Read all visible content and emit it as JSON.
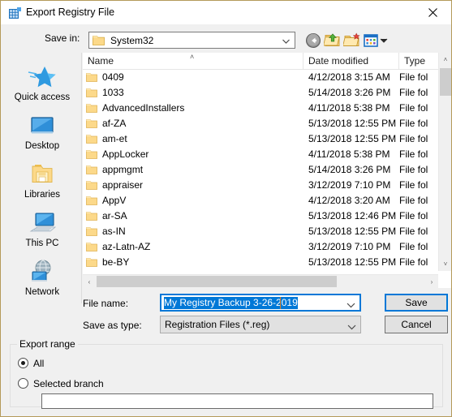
{
  "window": {
    "title": "Export Registry File",
    "icon": "registry-editor-icon",
    "close_label": "✕",
    "border_color": "#b49a5a"
  },
  "toolbar": {
    "savein_label": "Save in:",
    "savein_value": "System32",
    "savein_folder_icon": "folder-icon",
    "dropdown_arrow": "chevron-down-icon",
    "buttons": [
      {
        "name": "back-button",
        "icon": "back-arrow-icon"
      },
      {
        "name": "up-one-level-button",
        "icon": "folder-up-arrow-icon"
      },
      {
        "name": "new-folder-button",
        "icon": "new-folder-icon"
      },
      {
        "name": "views-button",
        "icon": "views-grid-icon"
      }
    ]
  },
  "places": {
    "items": [
      {
        "label": "Quick access",
        "icon": "star-icon"
      },
      {
        "label": "Desktop",
        "icon": "monitor-icon"
      },
      {
        "label": "Libraries",
        "icon": "libraries-folder-icon"
      },
      {
        "label": "This PC",
        "icon": "computer-icon"
      },
      {
        "label": "Network",
        "icon": "network-globe-icon"
      }
    ]
  },
  "filelist": {
    "columns": [
      "Name",
      "Date modified",
      "Type"
    ],
    "sort_indicator": "˄",
    "rows": [
      {
        "name": "0409",
        "date": "4/12/2018 3:15 AM",
        "type": "File fol"
      },
      {
        "name": "1033",
        "date": "5/14/2018 3:26 PM",
        "type": "File fol"
      },
      {
        "name": "AdvancedInstallers",
        "date": "4/11/2018 5:38 PM",
        "type": "File fol"
      },
      {
        "name": "af-ZA",
        "date": "5/13/2018 12:55 PM",
        "type": "File fol"
      },
      {
        "name": "am-et",
        "date": "5/13/2018 12:55 PM",
        "type": "File fol"
      },
      {
        "name": "AppLocker",
        "date": "4/11/2018 5:38 PM",
        "type": "File fol"
      },
      {
        "name": "appmgmt",
        "date": "5/14/2018 3:26 PM",
        "type": "File fol"
      },
      {
        "name": "appraiser",
        "date": "3/12/2019 7:10 PM",
        "type": "File fol"
      },
      {
        "name": "AppV",
        "date": "4/12/2018 3:20 AM",
        "type": "File fol"
      },
      {
        "name": "ar-SA",
        "date": "5/13/2018 12:46 PM",
        "type": "File fol"
      },
      {
        "name": "as-IN",
        "date": "5/13/2018 12:55 PM",
        "type": "File fol"
      },
      {
        "name": "az-Latn-AZ",
        "date": "3/12/2019 7:10 PM",
        "type": "File fol"
      },
      {
        "name": "be-BY",
        "date": "5/13/2018 12:55 PM",
        "type": "File fol"
      }
    ],
    "scroll_up": "˄",
    "scroll_down": "˅",
    "scroll_left": "‹",
    "scroll_right": "›"
  },
  "form": {
    "filename_label": "File name:",
    "filename_value": "My Registry Backup 3-26-2019",
    "savetype_label": "Save as type:",
    "savetype_value": "Registration Files (*.reg)",
    "save_button": "Save",
    "cancel_button": "Cancel",
    "accent_color": "#0078d7",
    "selection_color": "#0078d7"
  },
  "export_range": {
    "legend": "Export range",
    "options": [
      {
        "label": "All",
        "selected": true
      },
      {
        "label": "Selected branch",
        "selected": false
      }
    ],
    "branch_value": ""
  }
}
